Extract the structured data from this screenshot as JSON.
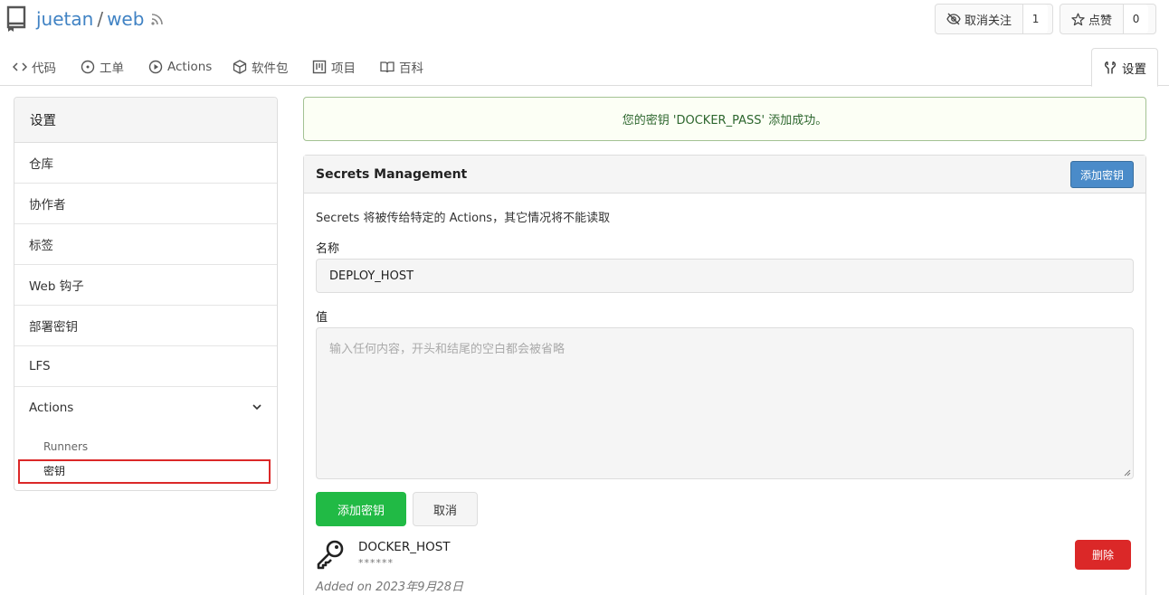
{
  "repo": {
    "owner": "juetan",
    "separator": "/",
    "name": "web",
    "icons": {
      "repo": "repo-icon",
      "rss": "rss-icon"
    }
  },
  "header_buttons": {
    "watch": {
      "label": "取消关注",
      "count": "1",
      "icon": "eye-slash-icon"
    },
    "star": {
      "label": "点赞",
      "count": "0",
      "icon": "star-icon"
    }
  },
  "tabs": [
    {
      "label": "代码",
      "icon": "code-icon"
    },
    {
      "label": "工单",
      "icon": "issue-icon"
    },
    {
      "label": "Actions",
      "icon": "play-icon"
    },
    {
      "label": "软件包",
      "icon": "package-icon"
    },
    {
      "label": "项目",
      "icon": "project-icon"
    },
    {
      "label": "百科",
      "icon": "book-icon"
    },
    {
      "label": "设置",
      "icon": "tools-icon",
      "active": true
    }
  ],
  "sidebar": {
    "title": "设置",
    "items": [
      {
        "label": "仓库"
      },
      {
        "label": "协作者"
      },
      {
        "label": "标签"
      },
      {
        "label": "Web 钩子"
      },
      {
        "label": "部署密钥"
      },
      {
        "label": "LFS"
      },
      {
        "label": "Actions"
      }
    ],
    "sub_items": [
      {
        "label": "Runners"
      },
      {
        "label": "密钥",
        "current": true
      }
    ]
  },
  "alert": {
    "message": "您的密钥 'DOCKER_PASS' 添加成功。"
  },
  "secrets": {
    "title": "Secrets Management",
    "add_button": "添加密钥",
    "description": "Secrets 将被传给特定的 Actions，其它情况将不能读取",
    "name_label": "名称",
    "name_value": "DEPLOY_HOST",
    "value_label": "值",
    "value_placeholder": "输入任何内容，开头和结尾的空白都会被省略",
    "submit_button": "添加密钥",
    "cancel_button": "取消",
    "list": [
      {
        "name": "DOCKER_HOST",
        "masked": "******",
        "added": "Added on 2023年9月28日",
        "delete_label": "删除",
        "icon": "key-icon"
      }
    ]
  },
  "colors": {
    "link": "#4183c4",
    "primary": "#4a8bc9",
    "success": "#21ba45",
    "danger": "#db2828",
    "alert_bg": "#fcfff5",
    "alert_text": "#2c662d"
  }
}
